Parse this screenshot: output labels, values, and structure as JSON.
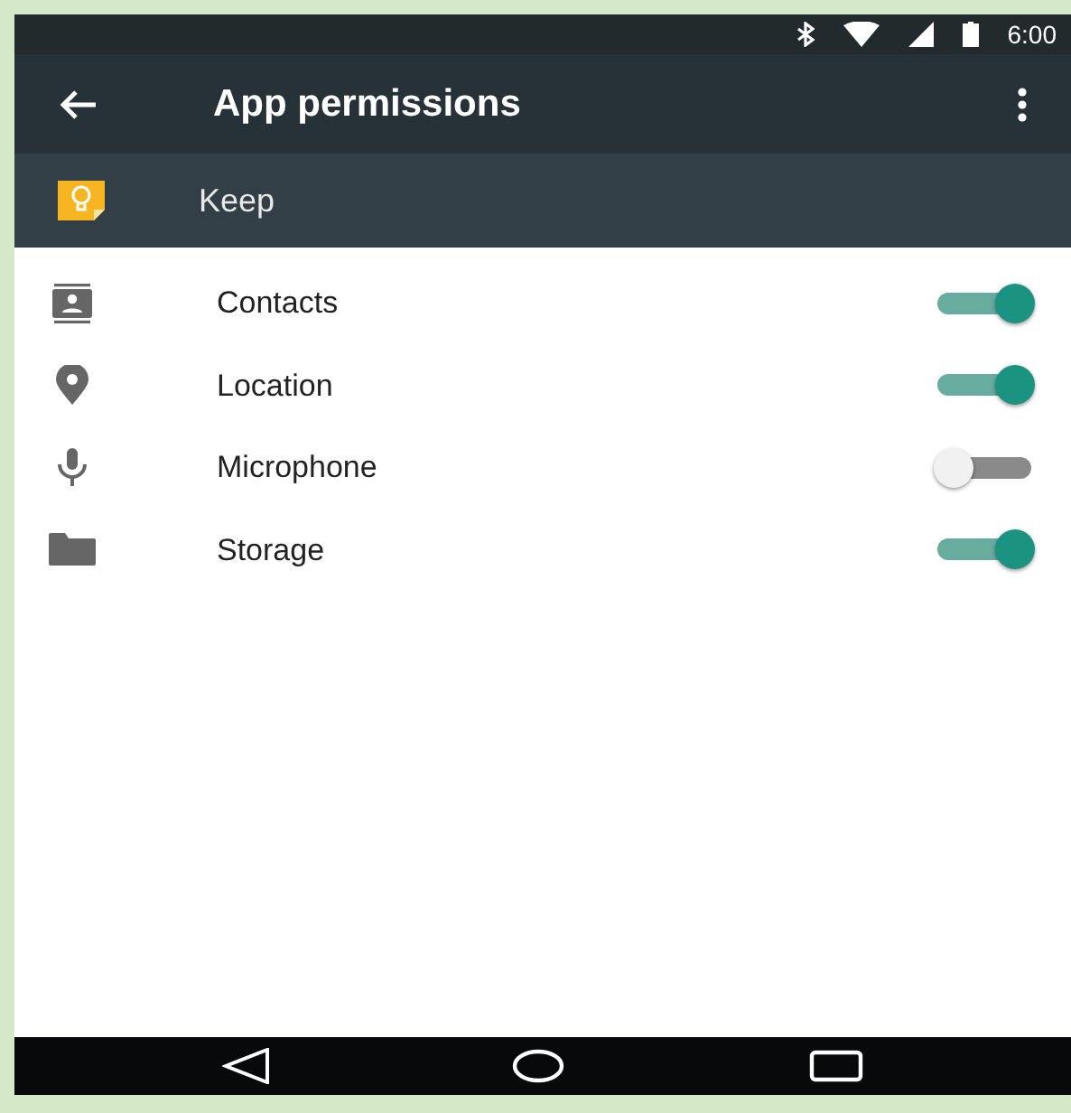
{
  "status_bar": {
    "time": "6:00"
  },
  "app_bar": {
    "title": "App permissions"
  },
  "app": {
    "name": "Keep"
  },
  "permissions": [
    {
      "kind": "contacts",
      "label": "Contacts",
      "on": true
    },
    {
      "kind": "location",
      "label": "Location",
      "on": true
    },
    {
      "kind": "microphone",
      "label": "Microphone",
      "on": false
    },
    {
      "kind": "storage",
      "label": "Storage",
      "on": true
    }
  ]
}
